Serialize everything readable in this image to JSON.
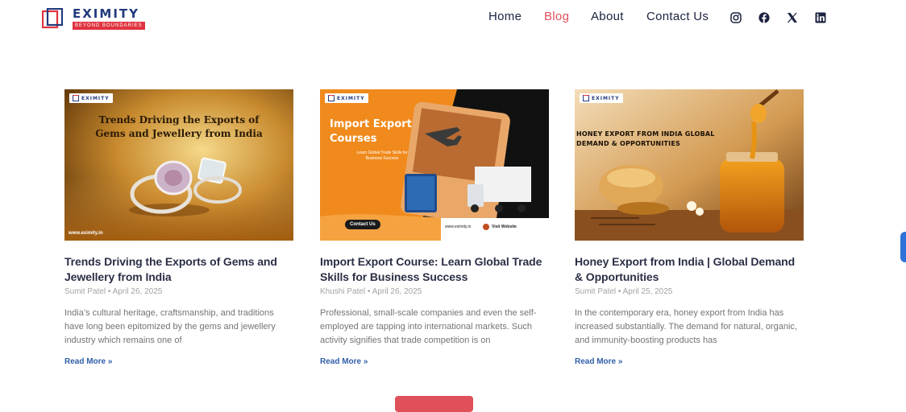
{
  "header": {
    "logo": {
      "name": "EXIMITY",
      "tagline": "BEYOND BOUNDARIES"
    },
    "nav": [
      {
        "label": "Home",
        "active": false
      },
      {
        "label": "Blog",
        "active": true
      },
      {
        "label": "About",
        "active": false
      },
      {
        "label": "Contact Us",
        "active": false
      }
    ],
    "social": [
      "instagram-icon",
      "facebook-icon",
      "x-icon",
      "linkedin-icon"
    ]
  },
  "posts": [
    {
      "thumb": {
        "brand": "EXIMITY",
        "headline": "Trends Driving the Exports of Gems and Jewellery from India",
        "url": "www.eximity.in"
      },
      "title": "Trends Driving the Exports of Gems and Jewellery from India",
      "meta": "Sumit Patel • April 26, 2025",
      "excerpt": "India’s cultural heritage, craftsmanship, and traditions have long been epitomized by the gems and jewellery industry which remains one of",
      "read_more": "Read More »"
    },
    {
      "thumb": {
        "brand": "EXIMITY",
        "headline": "Import Export Courses",
        "sub": "Learn Global Trade Skills for Business Success",
        "button": "Contact Us",
        "url": "www.eximity.in",
        "visit": "Visit Website"
      },
      "title": "Import Export Course: Learn Global Trade Skills for Business Success",
      "meta": "Khushi Patel • April 26, 2025",
      "excerpt": "Professional, small-scale companies and even the self-employed are tapping into international markets. Such activity signifies that trade competition is on",
      "read_more": "Read More »"
    },
    {
      "thumb": {
        "brand": "EXIMITY",
        "headline": "HONEY EXPORT FROM INDIA GLOBAL DEMAND & OPPORTUNITIES"
      },
      "title": "Honey Export from India | Global Demand & Opportunities",
      "meta": "Sumit Patel • April 25, 2025",
      "excerpt": "In the contemporary era, honey export from India has increased substantially. The demand for natural, organic, and immunity-boosting products has",
      "read_more": "Read More »"
    }
  ],
  "colors": {
    "brand_navy": "#233a7d",
    "brand_red": "#e0343f",
    "link": "#2f5fa8",
    "active_nav": "#e0505a"
  }
}
